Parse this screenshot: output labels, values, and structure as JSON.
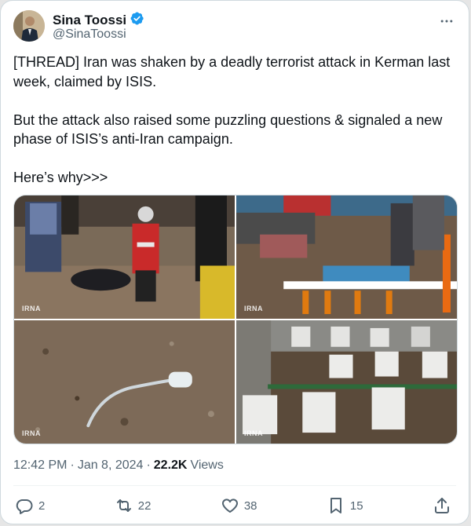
{
  "author": {
    "display_name": "Sina Toossi",
    "handle": "@SinaToossi",
    "verified": true,
    "verified_color": "#1d9bf0"
  },
  "tweet": {
    "paragraphs": [
      "[THREAD] Iran was shaken by a deadly terrorist attack in Kerman last week, claimed by ISIS.",
      "But the attack also raised some puzzling questions & signaled a new phase of ISIS’s anti-Iran campaign.",
      "Here’s why>>>"
    ]
  },
  "media": {
    "watermark": "IRNA",
    "images": [
      "injured-people-photo",
      "damaged-ground-photo",
      "wire-debris-photo",
      "graves-photo"
    ]
  },
  "meta": {
    "time": "12:42 PM",
    "separator": "·",
    "date": "Jan 8, 2024",
    "views_count": "22.2K",
    "views_label": "Views"
  },
  "actions": {
    "reply_count": "2",
    "retweet_count": "22",
    "like_count": "38",
    "bookmark_count": "15"
  },
  "icons": [
    "verified-badge-icon",
    "more-icon",
    "reply-icon",
    "retweet-icon",
    "like-icon",
    "bookmark-icon",
    "share-icon"
  ]
}
